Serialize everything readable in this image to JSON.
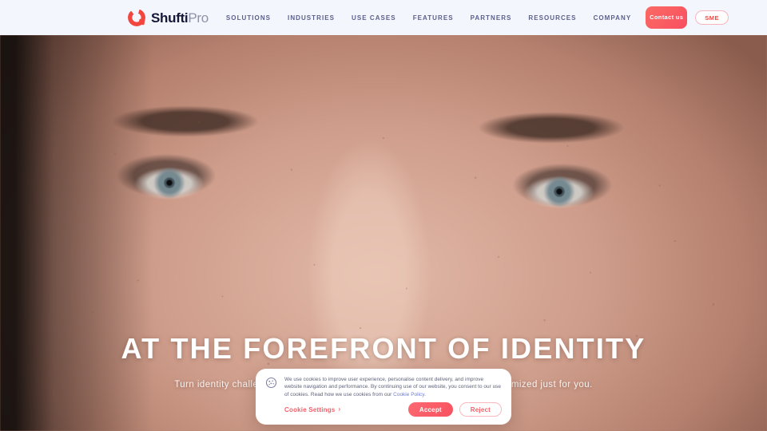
{
  "header": {
    "logo": {
      "icon": "shufti-ring-logo-icon",
      "name_bold": "Shufti",
      "name_light": "Pro",
      "accent_color": "#f2463f"
    },
    "nav_items": [
      {
        "label": "SOLUTIONS"
      },
      {
        "label": "INDUSTRIES"
      },
      {
        "label": "USE CASES"
      },
      {
        "label": "FEATURES"
      },
      {
        "label": "PARTNERS"
      },
      {
        "label": "RESOURCES"
      },
      {
        "label": "COMPANY"
      }
    ],
    "contact_button": "Contact us",
    "sme_button": "SME",
    "background_color": "#f3f6fd",
    "nav_text_color": "#5b5f8c"
  },
  "hero": {
    "title": "AT THE FOREFRONT OF IDENTITY",
    "subtitle": "Turn identity challenges into a competitive advantage with AI solutions customized just for you.",
    "subtitle_visible_start": "Turn identity challenges",
    "subtitle_visible_end": "customized just for you.",
    "image_description": "close-up photograph of a freckled face with gray-blue eyes"
  },
  "cookie_banner": {
    "icon": "cookie-icon",
    "body_text_part1": "We use cookies to improve user experience, personalise content delivery, and improve website navigation and performance. By continuing use of our website, you consent to our use of cookies. Read how we use cookies from our ",
    "policy_link": "Cookie Policy",
    "body_text_part2": ".",
    "settings_label": "Cookie Settings",
    "settings_chevron": "›",
    "accept_label": "Accept",
    "reject_label": "Reject",
    "accent_color": "#f65f68",
    "link_color": "#6b7ae0"
  }
}
